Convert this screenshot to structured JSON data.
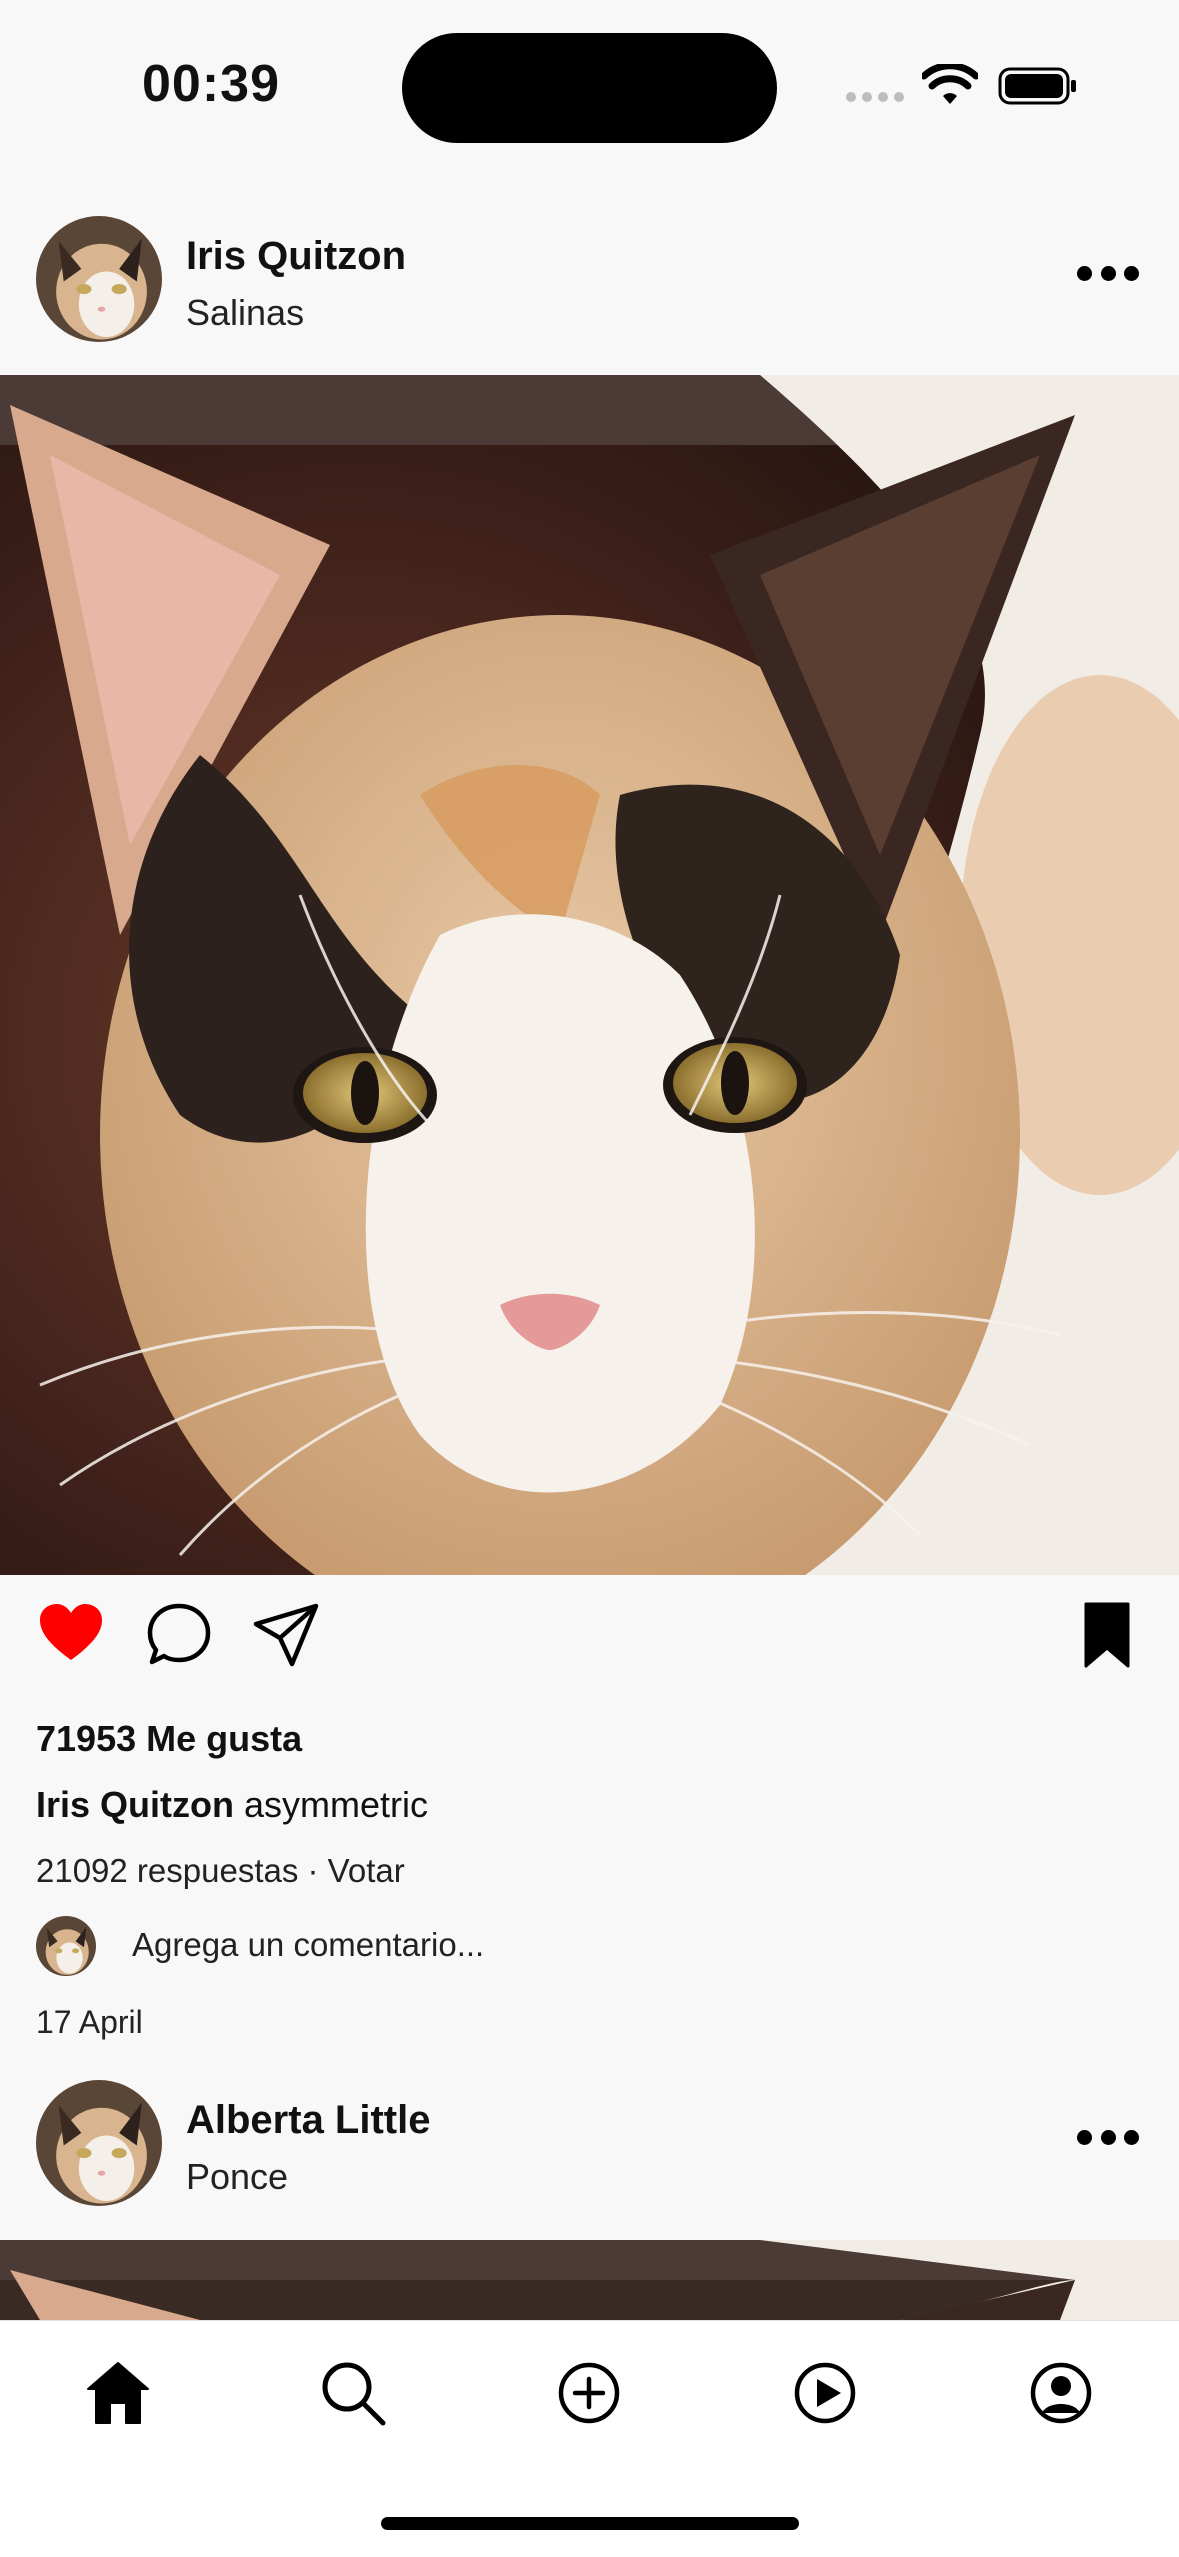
{
  "status_bar": {
    "time": "00:39"
  },
  "posts": [
    {
      "user": "Iris Quitzon",
      "location": "Salinas",
      "likes": "71953 Me gusta",
      "caption_user": "Iris Quitzon",
      "caption_text": "asymmetric",
      "replies": "21092 respuestas · Votar",
      "comment_placeholder": "Agrega un comentario...",
      "date": "17 April",
      "liked": true,
      "saved": true
    },
    {
      "user": "Alberta Little",
      "location": "Ponce"
    }
  ],
  "icons": {
    "more": "more-horizontal-icon",
    "like": "heart-icon",
    "comment": "comment-bubble-icon",
    "share": "paper-plane-icon",
    "save": "bookmark-icon",
    "nav": [
      "home-icon",
      "search-icon",
      "add-icon",
      "play-icon",
      "profile-icon"
    ]
  },
  "colors": {
    "like_active": "#ff0000",
    "background": "#f8f8f8",
    "text": "#111111"
  }
}
